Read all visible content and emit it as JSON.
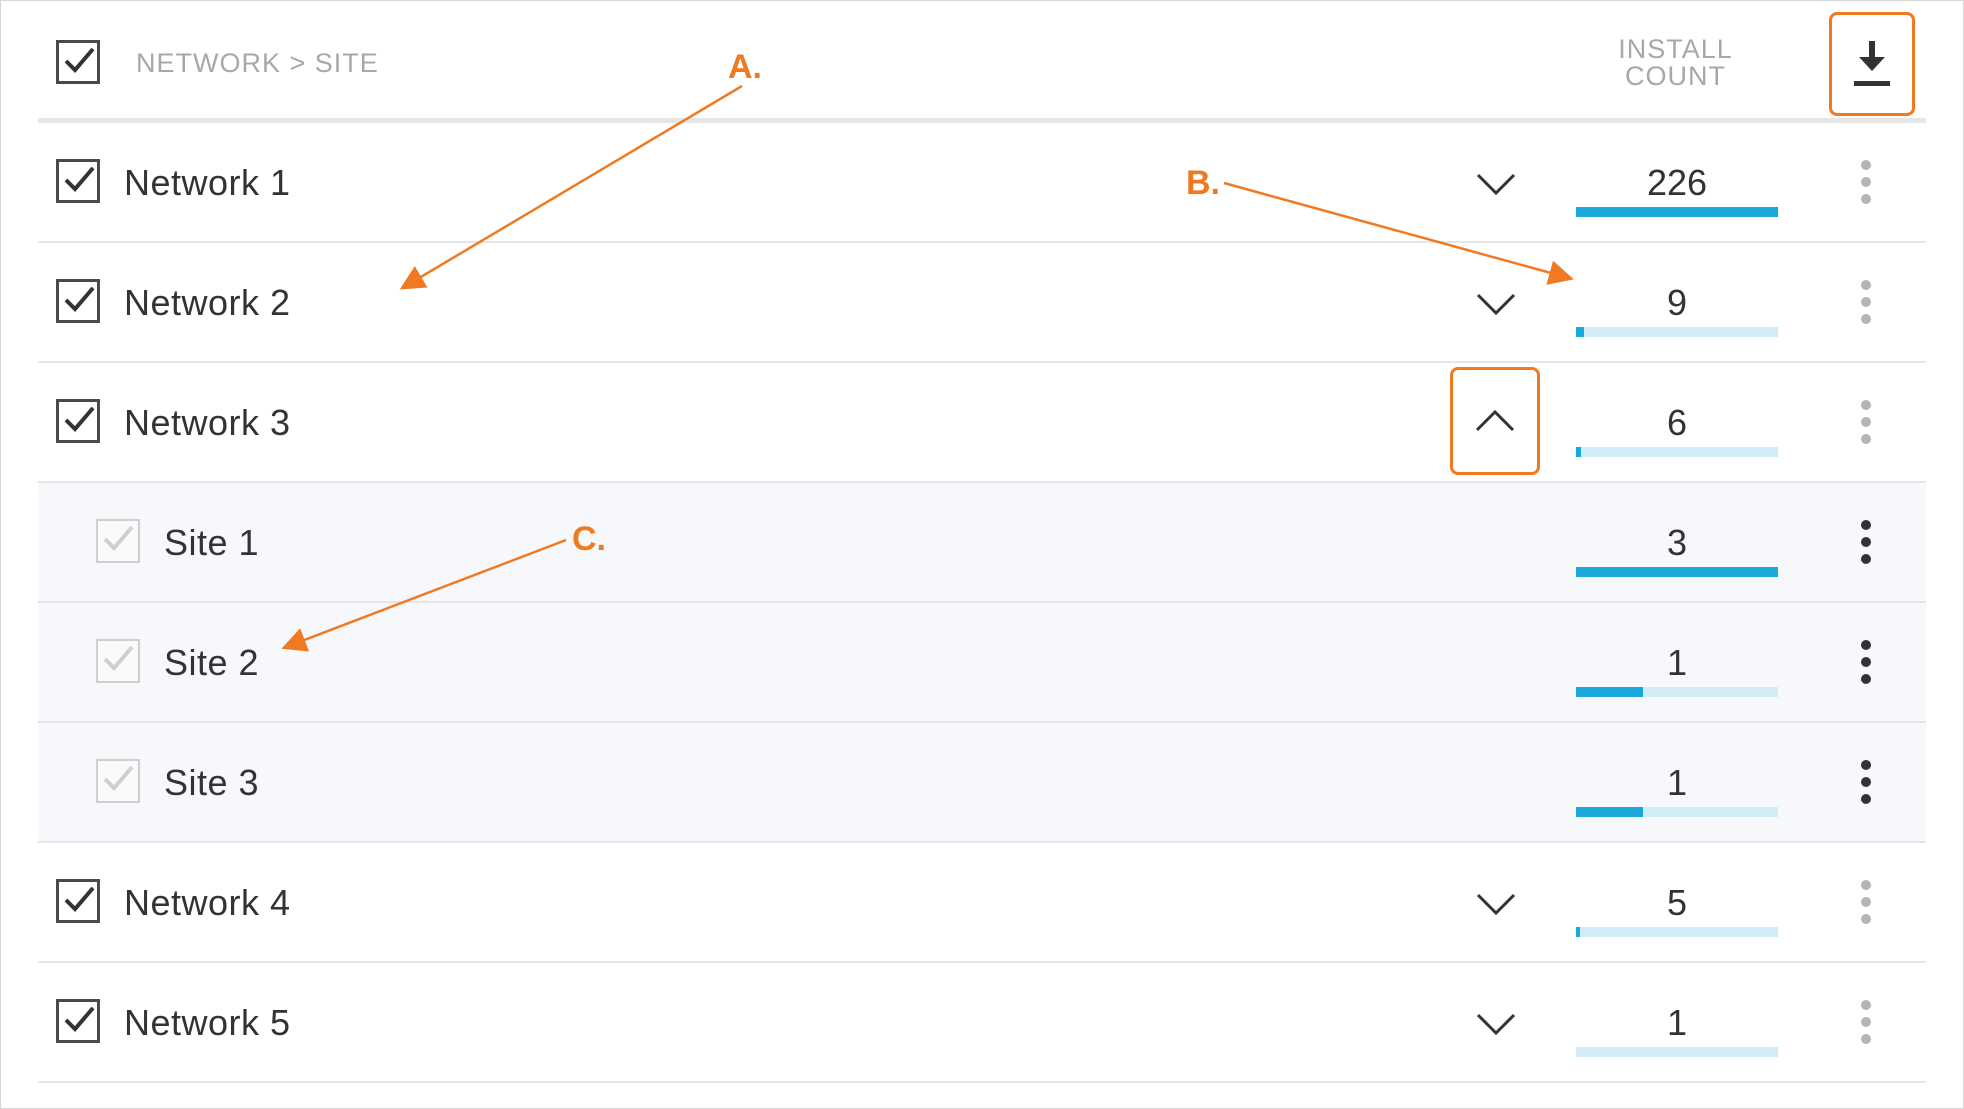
{
  "header": {
    "column_title": "NETWORK > SITE",
    "count_title_line1": "INSTALL",
    "count_title_line2": "COUNT",
    "download_icon": "download-icon",
    "select_all_checked": true
  },
  "rows": [
    {
      "label": "Network 1",
      "type": "network",
      "count": "226",
      "bar_fraction": 1.0,
      "expanded": false
    },
    {
      "label": "Network 2",
      "type": "network",
      "count": "9",
      "bar_fraction": 0.04,
      "expanded": false
    },
    {
      "label": "Network 3",
      "type": "network",
      "count": "6",
      "bar_fraction": 0.027,
      "expanded": true
    },
    {
      "label": "Site 1",
      "type": "site",
      "count": "3",
      "bar_fraction": 1.0
    },
    {
      "label": "Site 2",
      "type": "site",
      "count": "1",
      "bar_fraction": 0.33
    },
    {
      "label": "Site 3",
      "type": "site",
      "count": "1",
      "bar_fraction": 0.33
    },
    {
      "label": "Network 4",
      "type": "network",
      "count": "5",
      "bar_fraction": 0.022,
      "expanded": false
    },
    {
      "label": "Network 5",
      "type": "network",
      "count": "1",
      "bar_fraction": 0.0,
      "expanded": false
    }
  ],
  "annotations": {
    "a": "A.",
    "b": "B.",
    "c": "C."
  },
  "colors": {
    "accent": "#f07a22",
    "bar_fill": "#1aa9da",
    "bar_track": "#d2ecf5"
  }
}
